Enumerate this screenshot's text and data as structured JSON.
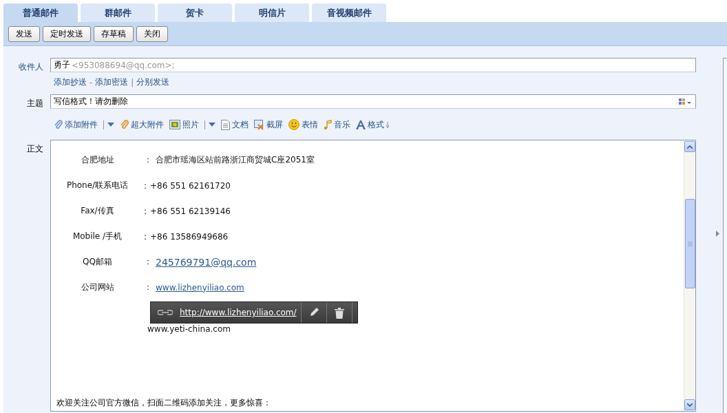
{
  "tabs": [
    {
      "label": "普通邮件",
      "selected": true
    },
    {
      "label": "群邮件",
      "selected": false
    },
    {
      "label": "贺卡",
      "selected": false
    },
    {
      "label": "明信片",
      "selected": false
    },
    {
      "label": "音视频邮件",
      "selected": false
    }
  ],
  "actions": [
    "发送",
    "定时发送",
    "存草稿",
    "关闭"
  ],
  "recipient": {
    "label": "收件人",
    "name": "勇子",
    "address": "<953088694@qq.com>;"
  },
  "recipient_links": [
    {
      "label": "添加抄送"
    },
    {
      "sep": "-",
      "label": "添加密送"
    },
    {
      "sep": "|",
      "label": "分别发送"
    }
  ],
  "subject": {
    "label": "主题",
    "value": "写信格式！请勿删除"
  },
  "attach_toolbar": [
    {
      "kind": "clip",
      "label": "添加附件",
      "dropdown": true
    },
    {
      "kind": "bigclip",
      "label": "超大附件",
      "dropdown": false
    },
    {
      "kind": "photo",
      "label": "照片",
      "dropdown": true
    },
    {
      "kind": "doc",
      "label": "文档",
      "dropdown": false
    },
    {
      "kind": "screen",
      "label": "截屏",
      "dropdown": false
    },
    {
      "kind": "smiley",
      "label": "表情",
      "dropdown": false
    },
    {
      "kind": "music",
      "label": "音乐",
      "dropdown": false
    },
    {
      "kind": "format",
      "label": "格式",
      "dropdown": false
    }
  ],
  "body": {
    "label": "正文",
    "rows": [
      {
        "label": "合肥地址",
        "sep": "：",
        "value": "合肥市瑶海区站前路浙江商贸城C座2051室",
        "kind": "text"
      },
      {
        "label": "Phone/联系电话",
        "sep": ":",
        "value": "+86 551 62161720",
        "kind": "text"
      },
      {
        "label": "Fax/传真",
        "sep": ":",
        "value": "+86 551 62139146",
        "kind": "text"
      },
      {
        "label": "Mobile /手机",
        "sep": ":",
        "value": "+86 13586949686",
        "kind": "text"
      },
      {
        "label": "QQ邮箱",
        "sep": "：",
        "value": "245769791@qq.com",
        "kind": "biglink"
      },
      {
        "label": "公司网站",
        "sep": "：",
        "value": "www.lizhenyiliao.com",
        "kind": "link"
      }
    ],
    "link_popup": {
      "url": "http://www.lizhenyiliao.com/"
    },
    "stray_text": "www.yeti-china.com",
    "footer": "欢迎关注公司官方微信，扫面二维码添加关注，更多惊喜："
  }
}
